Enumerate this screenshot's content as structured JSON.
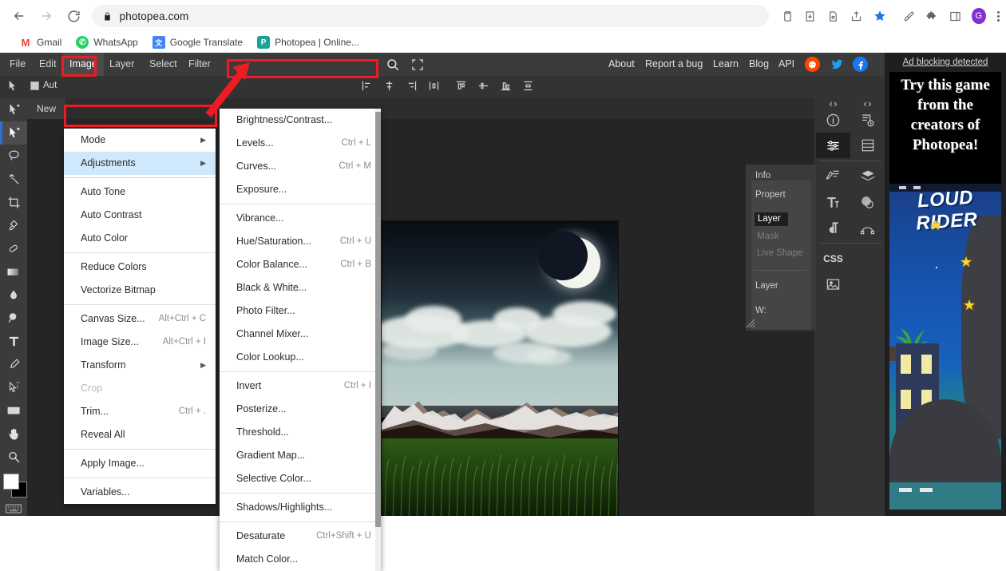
{
  "browser": {
    "url": "photopea.com",
    "back_label": "back-arrow",
    "forward_label": "forward-arrow",
    "reload_label": "reload",
    "lock_icon": "lock-icon",
    "toolbar_icons": [
      "clipboard-icon",
      "download-icon",
      "document-search-icon",
      "share-icon",
      "bookmark-star-icon",
      "eyedropper-icon",
      "extensions-puzzle-icon",
      "sidebar-icon"
    ],
    "profile_initial": "G",
    "bookmarks": [
      {
        "label": "Gmail",
        "glyph": "M",
        "name": "gmail"
      },
      {
        "label": "WhatsApp",
        "glyph": "✆",
        "name": "whatsapp"
      },
      {
        "label": "Google Translate",
        "glyph": "文",
        "name": "translate"
      },
      {
        "label": "Photopea | Online...",
        "glyph": "P",
        "name": "photopea"
      }
    ]
  },
  "photopea": {
    "menubar": [
      "File",
      "Edit",
      "Image",
      "Layer",
      "Select",
      "Filter"
    ],
    "active_menu": "Image",
    "right_links": [
      "About",
      "Report a bug",
      "Learn",
      "Blog",
      "API"
    ],
    "social": [
      "reddit-icon",
      "twitter-icon",
      "facebook-icon"
    ],
    "options": {
      "auto_select_label": "Auto-Select:",
      "auto_select_short": "Aut"
    },
    "tab_label": "New Project",
    "tab_short": "New",
    "tools": [
      "move-tool",
      "move-tool-alt",
      "lasso-tool",
      "magic-wand-tool",
      "crop-tool",
      "eyedropper-tool",
      "healing-brush-tool",
      "gradient-tool",
      "blur-tool",
      "dodge-tool",
      "type-tool",
      "pen-tool",
      "path-select-tool",
      "shape-tool",
      "hand-tool",
      "zoom-tool"
    ],
    "foreground_color": "#ffffff",
    "background_color": "#000000",
    "panel": {
      "tabs": [
        "Info",
        "Propert"
      ],
      "property_rows": [
        "Layer",
        "Mask",
        "Live Shape"
      ],
      "selected_property": "Layer",
      "section_label": "Layer",
      "width_label": "W:"
    },
    "dock_icons": [
      "info-icon",
      "history-icon",
      "adjustments-icon",
      "channels-icon",
      "brush-icon",
      "layers-icon",
      "character-icon",
      "swatches-icon",
      "paragraph-icon",
      "paths-icon",
      "css-icon",
      "image-icon"
    ],
    "image_menu": [
      {
        "label": "Mode",
        "key": "",
        "submenu": true
      },
      {
        "label": "Adjustments",
        "key": "",
        "submenu": true,
        "highlight": true
      },
      {
        "sep": true
      },
      {
        "label": "Auto Tone",
        "key": ""
      },
      {
        "label": "Auto Contrast",
        "key": ""
      },
      {
        "label": "Auto Color",
        "key": ""
      },
      {
        "sep": true
      },
      {
        "label": "Reduce Colors",
        "key": ""
      },
      {
        "label": "Vectorize Bitmap",
        "key": ""
      },
      {
        "sep": true
      },
      {
        "label": "Canvas Size...",
        "key": "Alt+Ctrl + C"
      },
      {
        "label": "Image Size...",
        "key": "Alt+Ctrl + I"
      },
      {
        "label": "Transform",
        "key": "",
        "submenu": true
      },
      {
        "label": "Crop",
        "key": "",
        "disabled": true
      },
      {
        "label": "Trim...",
        "key": "Ctrl + ."
      },
      {
        "label": "Reveal All",
        "key": ""
      },
      {
        "sep": true
      },
      {
        "label": "Apply Image...",
        "key": ""
      },
      {
        "sep": true
      },
      {
        "label": "Variables...",
        "key": ""
      }
    ],
    "adjustments_menu": [
      {
        "label": "Brightness/Contrast...",
        "key": ""
      },
      {
        "label": "Levels...",
        "key": "Ctrl + L"
      },
      {
        "label": "Curves...",
        "key": "Ctrl + M"
      },
      {
        "label": "Exposure...",
        "key": ""
      },
      {
        "sep": true
      },
      {
        "label": "Vibrance...",
        "key": ""
      },
      {
        "label": "Hue/Saturation...",
        "key": "Ctrl + U"
      },
      {
        "label": "Color Balance...",
        "key": "Ctrl + B"
      },
      {
        "label": "Black & White...",
        "key": ""
      },
      {
        "label": "Photo Filter...",
        "key": ""
      },
      {
        "label": "Channel Mixer...",
        "key": ""
      },
      {
        "label": "Color Lookup...",
        "key": ""
      },
      {
        "sep": true
      },
      {
        "label": "Invert",
        "key": "Ctrl + I"
      },
      {
        "label": "Posterize...",
        "key": ""
      },
      {
        "label": "Threshold...",
        "key": ""
      },
      {
        "label": "Gradient Map...",
        "key": ""
      },
      {
        "label": "Selective Color...",
        "key": ""
      },
      {
        "sep": true
      },
      {
        "label": "Shadows/Highlights...",
        "key": ""
      },
      {
        "sep": true
      },
      {
        "label": "Desaturate",
        "key": "Ctrl+Shift + U"
      },
      {
        "label": "Match Color...",
        "key": ""
      }
    ]
  },
  "ad": {
    "blocking_message": "Ad blocking detected",
    "headline": "Try this game from the creators of Photopea!",
    "game_title": "LOUD RIDER"
  },
  "annotations": {
    "color": "#ee1b24",
    "boxes": [
      "Image menu",
      "Adjustments item",
      "Brightness/Contrast item"
    ],
    "arrow": "arrow from Adjustments to Brightness/Contrast"
  }
}
